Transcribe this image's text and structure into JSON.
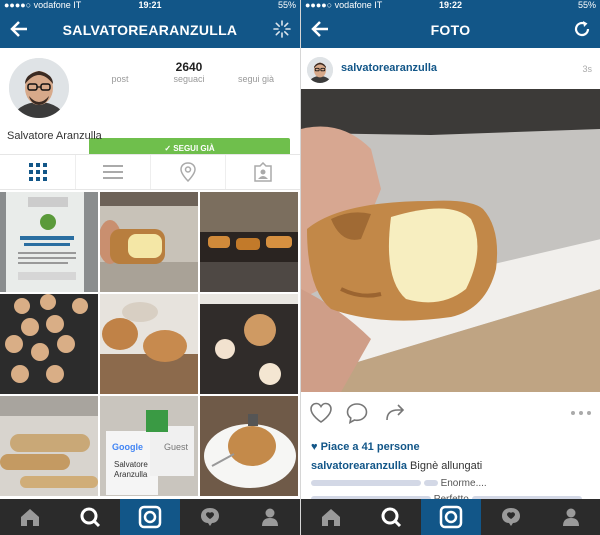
{
  "left": {
    "status": {
      "carrier": "●●●●○ vodafone IT",
      "time": "19:21",
      "battery": "55%"
    },
    "nav": {
      "title": "SALVATOREARANZULLA",
      "back": "back-arrow-icon",
      "action": "loading-spinner-icon"
    },
    "profile": {
      "posts": {
        "value": "",
        "label": "post"
      },
      "followers": {
        "value": "2640",
        "label": "seguaci"
      },
      "following": {
        "value": "",
        "label": "segui già"
      },
      "follow_button": "✓ SEGUI GIÀ",
      "full_name": "Salvatore Aranzulla"
    },
    "view_tabs": [
      "grid-icon",
      "list-icon",
      "location-pin-icon",
      "tagged-person-icon"
    ],
    "grid_cells": [
      {
        "name": "poster-photo",
        "text": ""
      },
      {
        "name": "cream-pastry-photo",
        "text": ""
      },
      {
        "name": "pastry-oven-photo",
        "text": ""
      },
      {
        "name": "dough-balls-photo",
        "text": ""
      },
      {
        "name": "choux-buns-photo",
        "text": ""
      },
      {
        "name": "baking-tray-photo",
        "text": ""
      },
      {
        "name": "eclair-pastries-photo",
        "text": ""
      },
      {
        "name": "google-guest-badge-photo",
        "google": "Google",
        "guest": "Guest",
        "name_line1": "Salvatore",
        "name_line2": "Aranzulla"
      },
      {
        "name": "cream-puff-plate-photo",
        "text": ""
      }
    ],
    "tabbar": [
      "home-icon",
      "search-icon",
      "camera-icon",
      "activity-icon",
      "profile-icon"
    ]
  },
  "right": {
    "status": {
      "carrier": "●●●●○ vodafone IT",
      "time": "19:22",
      "battery": "55%"
    },
    "nav": {
      "title": "FOTO",
      "back": "back-arrow-icon",
      "action": "refresh-icon"
    },
    "post": {
      "username": "salvatorearanzulla",
      "time": "3s",
      "likes": "♥ Piace a 41 persone",
      "caption_user": "salvatorearanzulla",
      "caption_text": " Bignè allungati",
      "comment1": "Enorme....",
      "comment2": "Perfetto"
    },
    "tabbar": [
      "home-icon",
      "search-icon",
      "camera-icon",
      "activity-icon",
      "profile-icon"
    ]
  },
  "colors": {
    "brand": "#125688",
    "follow_green": "#6fbf4c",
    "tabbar": "#2b2b2b"
  }
}
